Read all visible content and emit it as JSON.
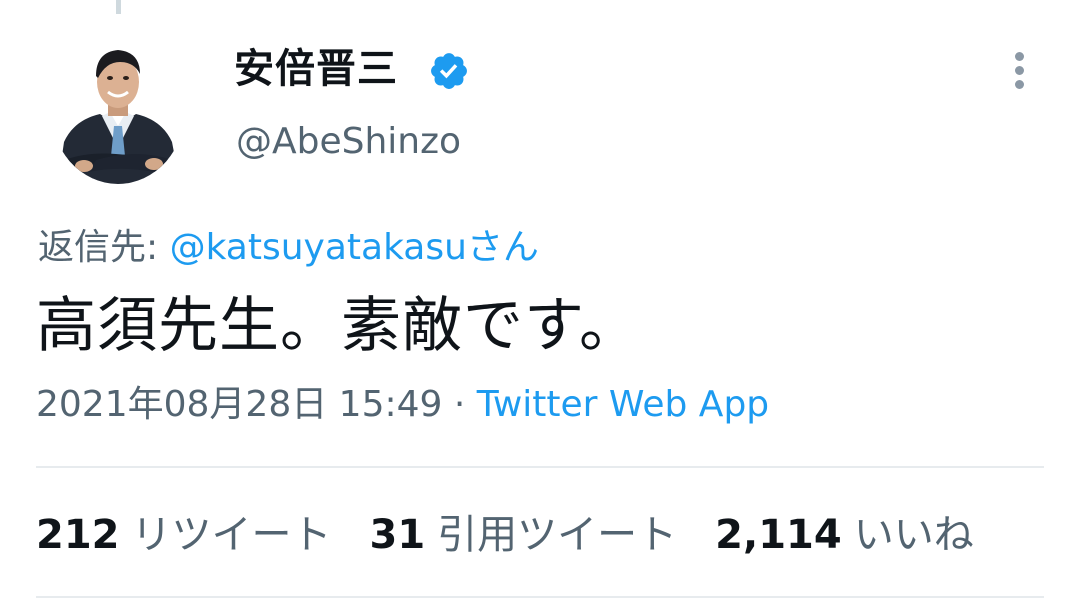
{
  "author": {
    "display_name": "安倍晋三",
    "handle": "@AbeShinzo",
    "verified": true
  },
  "reply": {
    "prefix": "返信先: ",
    "mention": "@katsuyatakasuさん"
  },
  "tweet": {
    "text": "高須先生。素敵です。",
    "timestamp": "2021年08月28日 15:49",
    "separator": " · ",
    "source": "Twitter Web App"
  },
  "stats": {
    "retweets": {
      "count": "212",
      "label": "リツイート"
    },
    "quote_tweets": {
      "count": "31",
      "label": "引用ツイート"
    },
    "likes": {
      "count": "2,114",
      "label": "いいね"
    }
  },
  "colors": {
    "accent": "#1d9bf0",
    "secondary_text": "#536471",
    "primary_text": "#0f1419"
  },
  "icons": {
    "verified": "verified-badge-icon",
    "more": "more-vertical-icon"
  }
}
